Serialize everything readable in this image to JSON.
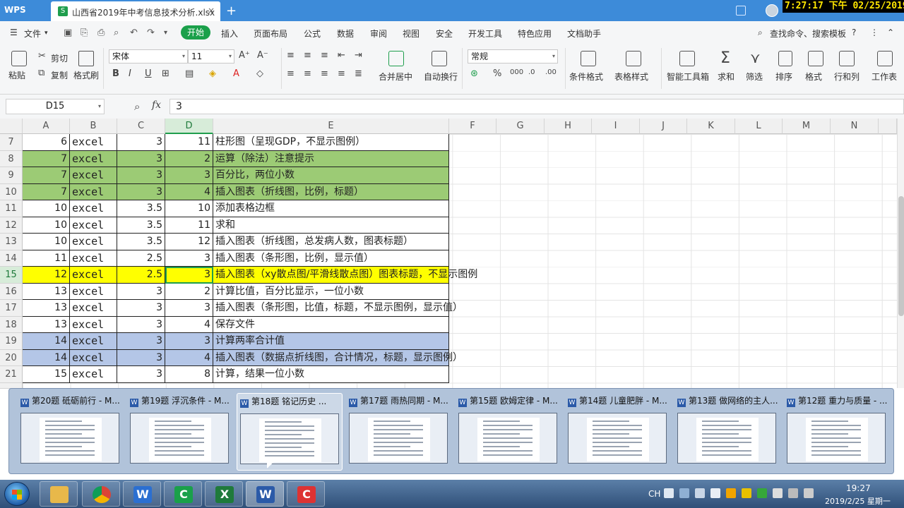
{
  "titlebar": {
    "app_name": "WPS",
    "doc_tab": "山西省2019年中考信息技术分析.xlsx",
    "close_glyph": "×",
    "new_tab_glyph": "+",
    "clock_overlay": "7:27:17 下午 02/25/2019"
  },
  "menu": {
    "file": "文件",
    "start": "开始",
    "items": [
      "插入",
      "页面布局",
      "公式",
      "数据",
      "审阅",
      "视图",
      "安全",
      "开发工具",
      "特色应用",
      "文档助手"
    ],
    "search": "查找命令、搜索模板"
  },
  "ribbon": {
    "paste": "粘贴",
    "cut": "剪切",
    "copy": "复制",
    "format_painter": "格式刷",
    "font_name": "宋体",
    "font_size": "11",
    "merge_center": "合并居中",
    "wrap_text": "自动换行",
    "number_format": "常规",
    "conditional_format": "条件格式",
    "table_style": "表格样式",
    "smart_toolbox": "智能工具箱",
    "sum": "求和",
    "filter": "筛选",
    "sort": "排序",
    "format": "格式",
    "row_col": "行和列",
    "worksheet": "工作表"
  },
  "formula_bar": {
    "name_box": "D15",
    "fx_label": "fx",
    "value": "3"
  },
  "sheet": {
    "columns": [
      "A",
      "B",
      "C",
      "D",
      "E",
      "F",
      "G",
      "H",
      "I",
      "J",
      "K",
      "L",
      "M",
      "N"
    ],
    "active_column": "D",
    "active_row": "15",
    "rows": [
      {
        "num": "7",
        "a": "6",
        "b": "excel",
        "c": "3",
        "d": "11",
        "e": "柱形图（呈现GDP，不显示图例）",
        "fill": "#ffffff"
      },
      {
        "num": "8",
        "a": "7",
        "b": "excel",
        "c": "3",
        "d": "2",
        "e": "运算（除法）注意提示",
        "fill": "#9ccb75"
      },
      {
        "num": "9",
        "a": "7",
        "b": "excel",
        "c": "3",
        "d": "3",
        "e": "百分比，两位小数",
        "fill": "#9ccb75"
      },
      {
        "num": "10",
        "a": "7",
        "b": "excel",
        "c": "3",
        "d": "4",
        "e": "插入图表（折线图，比例，标题）",
        "fill": "#9ccb75"
      },
      {
        "num": "11",
        "a": "10",
        "b": "excel",
        "c": "3.5",
        "d": "10",
        "e": "添加表格边框",
        "fill": "#ffffff"
      },
      {
        "num": "12",
        "a": "10",
        "b": "excel",
        "c": "3.5",
        "d": "11",
        "e": "求和",
        "fill": "#ffffff"
      },
      {
        "num": "13",
        "a": "10",
        "b": "excel",
        "c": "3.5",
        "d": "12",
        "e": "插入图表（折线图，总发病人数，图表标题）",
        "fill": "#ffffff"
      },
      {
        "num": "14",
        "a": "11",
        "b": "excel",
        "c": "2.5",
        "d": "3",
        "e": "插入图表（条形图，比例，显示值）",
        "fill": "#ffffff"
      },
      {
        "num": "15",
        "a": "12",
        "b": "excel",
        "c": "2.5",
        "d": "3",
        "e": "插入图表（xy散点图/平滑线散点图）图表标题，不显示图例",
        "fill": "#ffff00"
      },
      {
        "num": "16",
        "a": "13",
        "b": "excel",
        "c": "3",
        "d": "2",
        "e": "计算比值，百分比显示，一位小数",
        "fill": "#ffffff"
      },
      {
        "num": "17",
        "a": "13",
        "b": "excel",
        "c": "3",
        "d": "3",
        "e": "插入图表（条形图，比值，标题，不显示图例，显示值）",
        "fill": "#ffffff"
      },
      {
        "num": "18",
        "a": "13",
        "b": "excel",
        "c": "3",
        "d": "4",
        "e": "保存文件",
        "fill": "#ffffff"
      },
      {
        "num": "19",
        "a": "14",
        "b": "excel",
        "c": "3",
        "d": "3",
        "e": "计算两率合计值",
        "fill": "#b4c6e7"
      },
      {
        "num": "20",
        "a": "14",
        "b": "excel",
        "c": "3",
        "d": "4",
        "e": "插入图表（数据点折线图，合计情况，标题，显示图例）",
        "fill": "#b4c6e7"
      },
      {
        "num": "21",
        "a": "15",
        "b": "excel",
        "c": "3",
        "d": "8",
        "e": "计算，结果一位小数",
        "fill": "#ffffff"
      }
    ]
  },
  "taskbar_previews": [
    {
      "title": "第20题 砥砺前行 - M..."
    },
    {
      "title": "第19题 浮沉条件 - M..."
    },
    {
      "title": "第18题 铭记历史 ..."
    },
    {
      "title": "第17题 雨热同期 - M..."
    },
    {
      "title": "第15题 欧姆定律 - M..."
    },
    {
      "title": "第14题 儿童肥胖 - M..."
    },
    {
      "title": "第13题 做网络的主人..."
    },
    {
      "title": "第12题 重力与质量 - ..."
    }
  ],
  "taskbar": {
    "apps": [
      {
        "name": "explorer",
        "letter": ""
      },
      {
        "name": "chrome",
        "letter": ""
      },
      {
        "name": "wps-office",
        "letter": "W"
      },
      {
        "name": "green-c",
        "letter": "C"
      },
      {
        "name": "excel",
        "letter": "X"
      },
      {
        "name": "word",
        "letter": "W"
      },
      {
        "name": "red-c",
        "letter": "C"
      }
    ],
    "ime": "CH",
    "time": "19:27",
    "date": "2019/2/25 星期一"
  }
}
